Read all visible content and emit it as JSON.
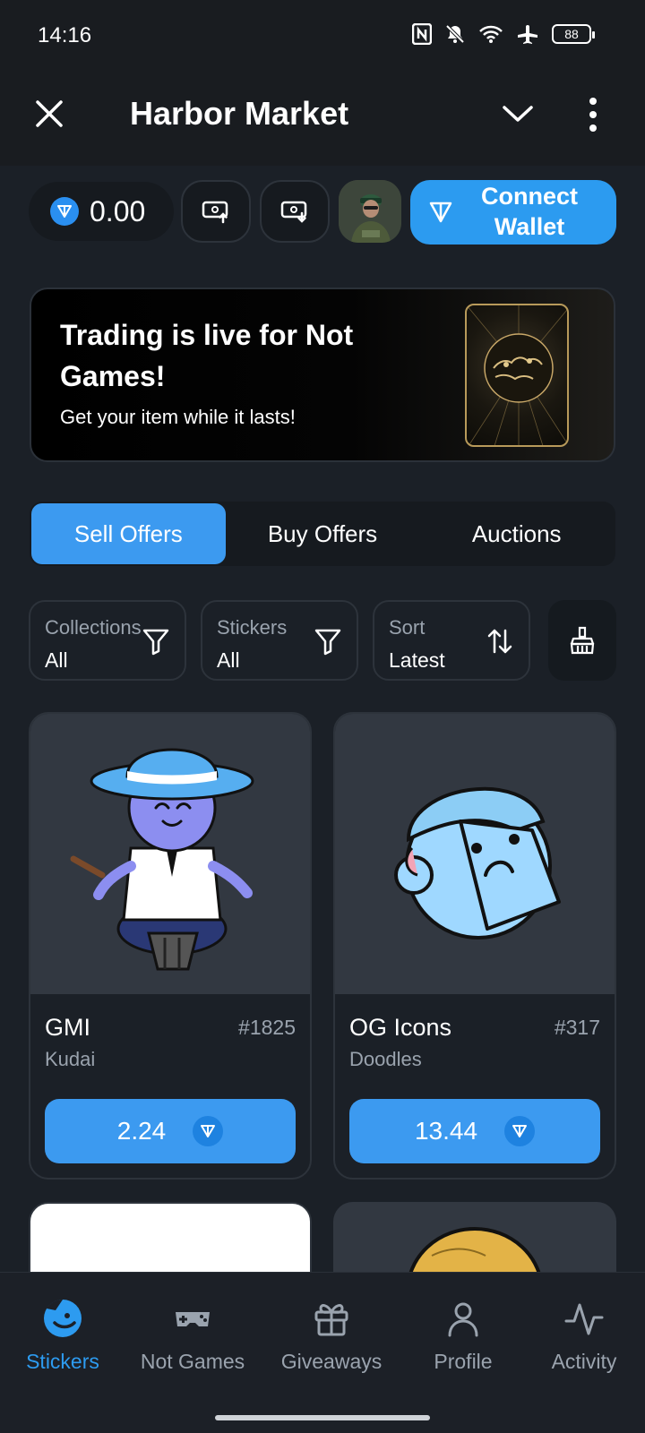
{
  "status_bar": {
    "time": "14:16",
    "battery": "88"
  },
  "header": {
    "title": "Harbor Market"
  },
  "wallet": {
    "balance": "0.00",
    "connect_label": "Connect Wallet"
  },
  "banner": {
    "title": "Trading is live for Not Games!",
    "subtitle": "Get your item while it lasts!"
  },
  "tabs": [
    {
      "label": "Sell Offers",
      "active": true
    },
    {
      "label": "Buy Offers",
      "active": false
    },
    {
      "label": "Auctions",
      "active": false
    }
  ],
  "filters": [
    {
      "label": "Collections",
      "value": "All",
      "icon": "filter-icon"
    },
    {
      "label": "Stickers",
      "value": "All",
      "icon": "filter-icon"
    },
    {
      "label": "Sort",
      "value": "Latest",
      "icon": "sort-icon"
    }
  ],
  "items": [
    {
      "name": "GMI",
      "number": "#1825",
      "collection": "Kudai",
      "price": "2.24"
    },
    {
      "name": "OG Icons",
      "number": "#317",
      "collection": "Doodles",
      "price": "13.44"
    }
  ],
  "nav": [
    {
      "label": "Stickers",
      "icon": "sticker-icon",
      "active": true
    },
    {
      "label": "Not Games",
      "icon": "gamepad-icon",
      "active": false
    },
    {
      "label": "Giveaways",
      "icon": "gift-icon",
      "active": false
    },
    {
      "label": "Profile",
      "icon": "person-icon",
      "active": false
    },
    {
      "label": "Activity",
      "icon": "activity-icon",
      "active": false
    }
  ],
  "colors": {
    "accent": "#3c9af0",
    "background": "#1b2027",
    "header": "#191c20"
  }
}
